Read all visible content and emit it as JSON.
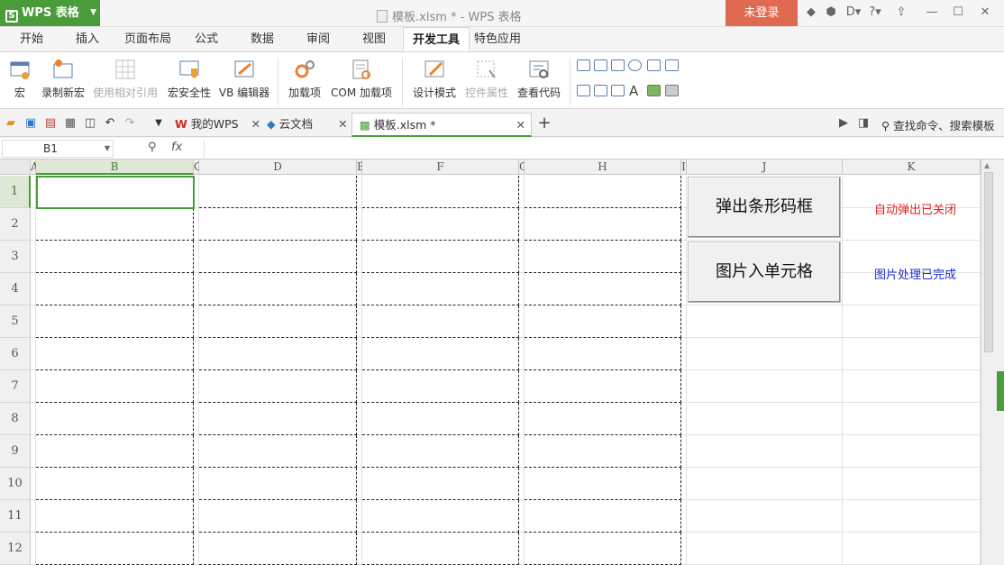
{
  "app": {
    "name": "WPS 表格",
    "logo": "S",
    "doc_title": "模板.xlsm * - WPS 表格",
    "login": "未登录"
  },
  "tabs": [
    "开始",
    "插入",
    "页面布局",
    "公式",
    "数据",
    "审阅",
    "视图",
    "开发工具",
    "特色应用"
  ],
  "active_tab": "开发工具",
  "ribbon": {
    "macro": "宏",
    "record": "录制新宏",
    "relative": "使用相对引用",
    "security": "宏安全性",
    "vb": "VB 编辑器",
    "addins": "加载项",
    "com": "COM 加载项",
    "design": "设计模式",
    "props": "控件属性",
    "code": "查看代码"
  },
  "doc_tabs": [
    "我的WPS",
    "云文档",
    "模板.xlsm *"
  ],
  "search_label": "查找命令、搜索模板",
  "namebox": "B1",
  "fx": "fx",
  "columns": [
    "A",
    "B",
    "C",
    "D",
    "E",
    "F",
    "G",
    "H",
    "I",
    "J",
    "K"
  ],
  "rows": [
    "1",
    "2",
    "3",
    "4",
    "5",
    "6",
    "7",
    "8",
    "9",
    "10",
    "11",
    "12"
  ],
  "buttons": {
    "barcode": "弹出条形码框",
    "picture": "图片入单元格"
  },
  "status": {
    "auto_popup": "自动弹出已关闭",
    "auto_popup_color": "#e02020",
    "picture_done": "图片处理已完成",
    "picture_done_color": "#1a2ed0"
  },
  "colors": {
    "accent": "#4a9b3a",
    "login_bg": "#e06a50"
  }
}
